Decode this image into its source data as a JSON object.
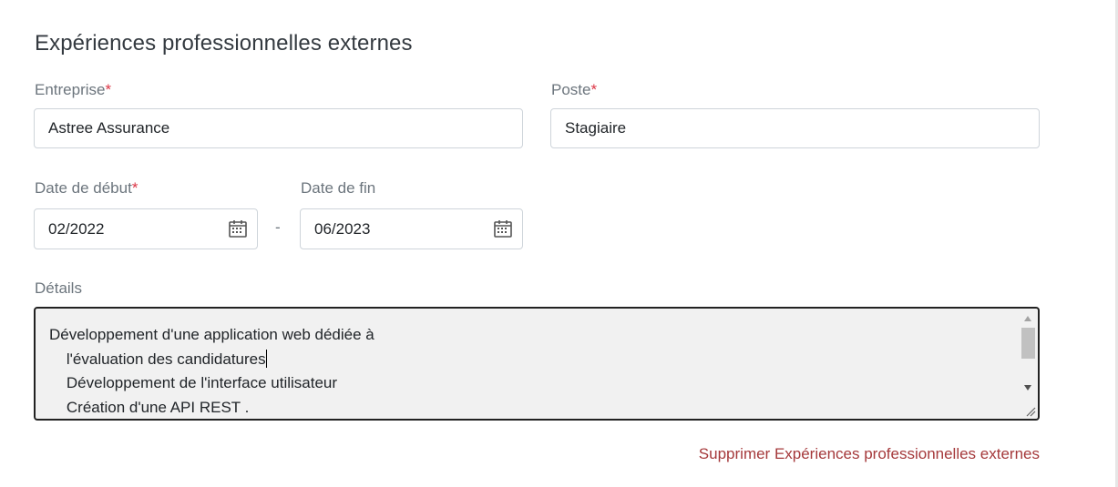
{
  "section": {
    "title": "Expériences professionnelles externes"
  },
  "fields": {
    "entreprise": {
      "label": "Entreprise",
      "required_mark": "*",
      "value": "Astree Assurance"
    },
    "poste": {
      "label": "Poste",
      "required_mark": "*",
      "value": "Stagiaire"
    },
    "date_debut": {
      "label": "Date de début",
      "required_mark": "*",
      "value": "02/2022"
    },
    "date_fin": {
      "label": "Date de fin",
      "value": "06/2023"
    },
    "date_separator": "-",
    "details": {
      "label": "Détails",
      "lines": [
        "Développement d'une application web dédiée à",
        "    l'évaluation des candidatures",
        "    Développement de l'interface utilisateur",
        "    Création d'une API REST ."
      ]
    }
  },
  "actions": {
    "delete_label": "Supprimer Expériences professionnelles externes"
  },
  "icons": {
    "date_picker": "calendar-icon"
  },
  "colors": {
    "required": "#dc3545",
    "delete_link": "#a5393b",
    "label": "#6c757d"
  }
}
